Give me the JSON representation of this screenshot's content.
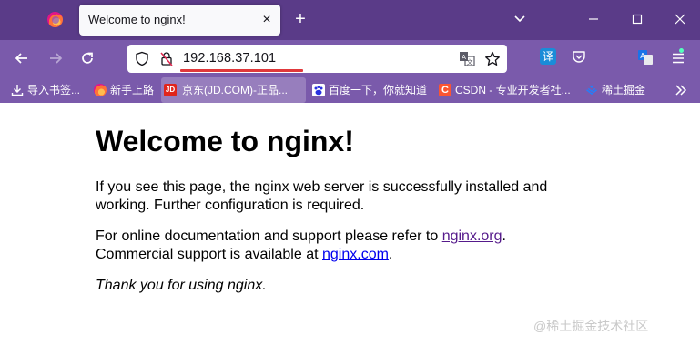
{
  "browser": {
    "tab": {
      "title": "Welcome to nginx!",
      "close_symbol": "×"
    },
    "new_tab_symbol": "+",
    "address": "192.168.37.101",
    "accent_underline_color": "#e0383b",
    "bookmarks": [
      {
        "label": "导入书签...",
        "icon": "import-icon"
      },
      {
        "label": "新手上路",
        "icon": "firefox-icon"
      },
      {
        "label": "京东(JD.COM)-正品...",
        "icon": "jd-icon",
        "badge": "JD"
      },
      {
        "label": "百度一下，你就知道",
        "icon": "baidu-icon"
      },
      {
        "label": "CSDN - 专业开发者社...",
        "icon": "csdn-icon",
        "badge": "C"
      },
      {
        "label": "稀土掘金",
        "icon": "juejin-icon"
      }
    ],
    "extension_badge": "译"
  },
  "page": {
    "heading": "Welcome to nginx!",
    "para1": "If you see this page, the nginx web server is successfully installed and working. Further configuration is required.",
    "para2_prefix": "For online documentation and support please refer to ",
    "link1": "nginx.org",
    "para2_mid": ".",
    "para2_line2": "Commercial support is available at ",
    "link2": "nginx.com",
    "para2_end": ".",
    "para3": "Thank you for using nginx."
  },
  "watermark": "@稀土掘金技术社区"
}
